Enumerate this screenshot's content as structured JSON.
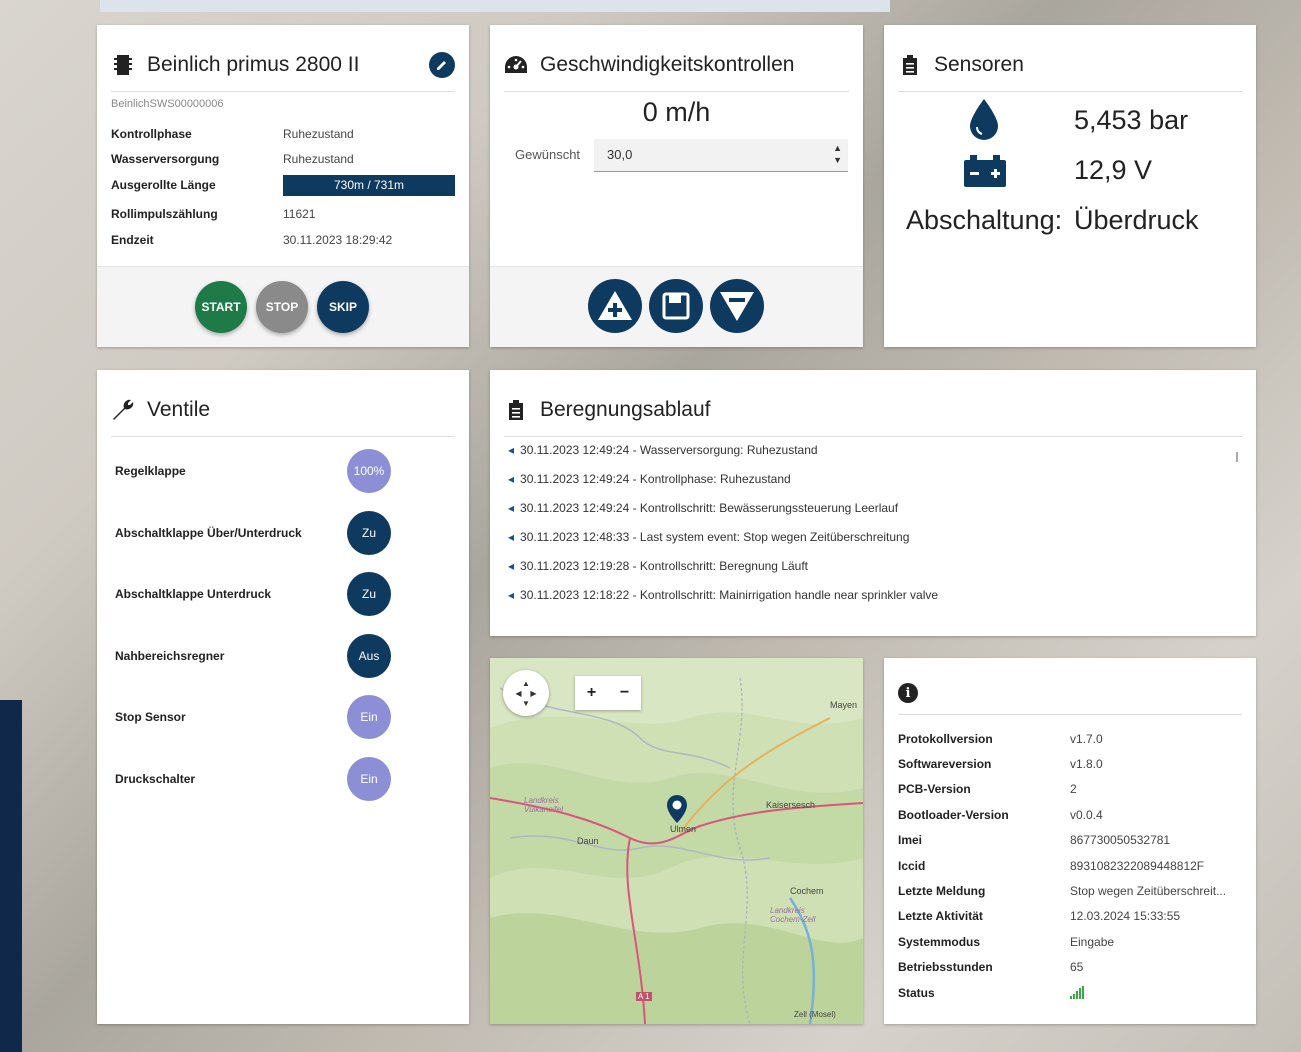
{
  "device": {
    "title": "Beinlich primus 2800 II",
    "serial": "BeinlichSWS00000006",
    "rows": [
      {
        "label": "Kontrollphase",
        "value": "Ruhezustand"
      },
      {
        "label": "Wasserversorgung",
        "value": "Ruhezustand"
      },
      {
        "label": "Ausgerollte Länge",
        "value": "730m / 731m"
      },
      {
        "label": "Rollimpulszählung",
        "value": "11621"
      },
      {
        "label": "Endzeit",
        "value": "30.11.2023 18:29:42"
      }
    ],
    "progress_fraction": 0.9986,
    "buttons": {
      "start": "START",
      "stop": "STOP",
      "skip": "SKIP"
    }
  },
  "speed": {
    "title": "Geschwindigkeitskontrollen",
    "current": "0 m/h",
    "desired_label": "Gewünscht",
    "desired_value": "30,0"
  },
  "sensors": {
    "title": "Sensoren",
    "pressure": "5,453 bar",
    "voltage": "12,9 V",
    "shutdown_label": "Abschaltung:",
    "shutdown_value": "Überdruck"
  },
  "valves": {
    "title": "Ventile",
    "items": [
      {
        "label": "Regelklappe",
        "state": "100%"
      },
      {
        "label": "Abschaltklappe Über/Unterdruck",
        "state": "Zu"
      },
      {
        "label": "Abschaltklappe Unterdruck",
        "state": "Zu"
      },
      {
        "label": "Nahbereichsregner",
        "state": "Aus"
      },
      {
        "label": "Stop Sensor",
        "state": "Ein"
      },
      {
        "label": "Druckschalter",
        "state": "Ein"
      }
    ]
  },
  "log": {
    "title": "Beregnungsablauf",
    "entries": [
      "30.11.2023 12:49:24 - Wasserversorgung: Ruhezustand",
      "30.11.2023 12:49:24 - Kontrollphase: Ruhezustand",
      "30.11.2023 12:49:24 - Kontrollschritt: Bewässerungssteuerung Leerlauf",
      "30.11.2023 12:48:33 - Last system event: Stop wegen Zeitüberschreitung",
      "30.11.2023 12:19:28 - Kontrollschritt: Beregnung Läuft",
      "30.11.2023 12:18:22 - Kontrollschritt: Mainirrigation handle near sprinkler valve"
    ]
  },
  "map": {
    "zoom_in": "+",
    "zoom_out": "−",
    "places": [
      "Mayen",
      "Kaisersesch",
      "Ulmen",
      "Daun",
      "Cochem",
      "Landkreis Vulkaneifel",
      "Landkreis Cochem-Zell",
      "A 1",
      "Zell (Mosel)"
    ]
  },
  "info": {
    "rows": [
      {
        "label": "Protokollversion",
        "value": "v1.7.0"
      },
      {
        "label": "Softwareversion",
        "value": "v1.8.0"
      },
      {
        "label": "PCB-Version",
        "value": "2"
      },
      {
        "label": "Bootloader-Version",
        "value": "v0.0.4"
      },
      {
        "label": "Imei",
        "value": "867730050532781"
      },
      {
        "label": "Iccid",
        "value": "8931082322089448812F"
      },
      {
        "label": "Letzte Meldung",
        "value": "Stop wegen Zeitüberschreit..."
      },
      {
        "label": "Letzte Aktivität",
        "value": "12.03.2024 15:33:55"
      },
      {
        "label": "Systemmodus",
        "value": "Eingabe"
      },
      {
        "label": "Betriebsstunden",
        "value": "65"
      },
      {
        "label": "Status",
        "value": ""
      }
    ]
  },
  "colors": {
    "navy": "#0f3a5f",
    "green": "#1e7a47",
    "grey": "#8a8a8a",
    "lavender": "#8c8fd6"
  }
}
